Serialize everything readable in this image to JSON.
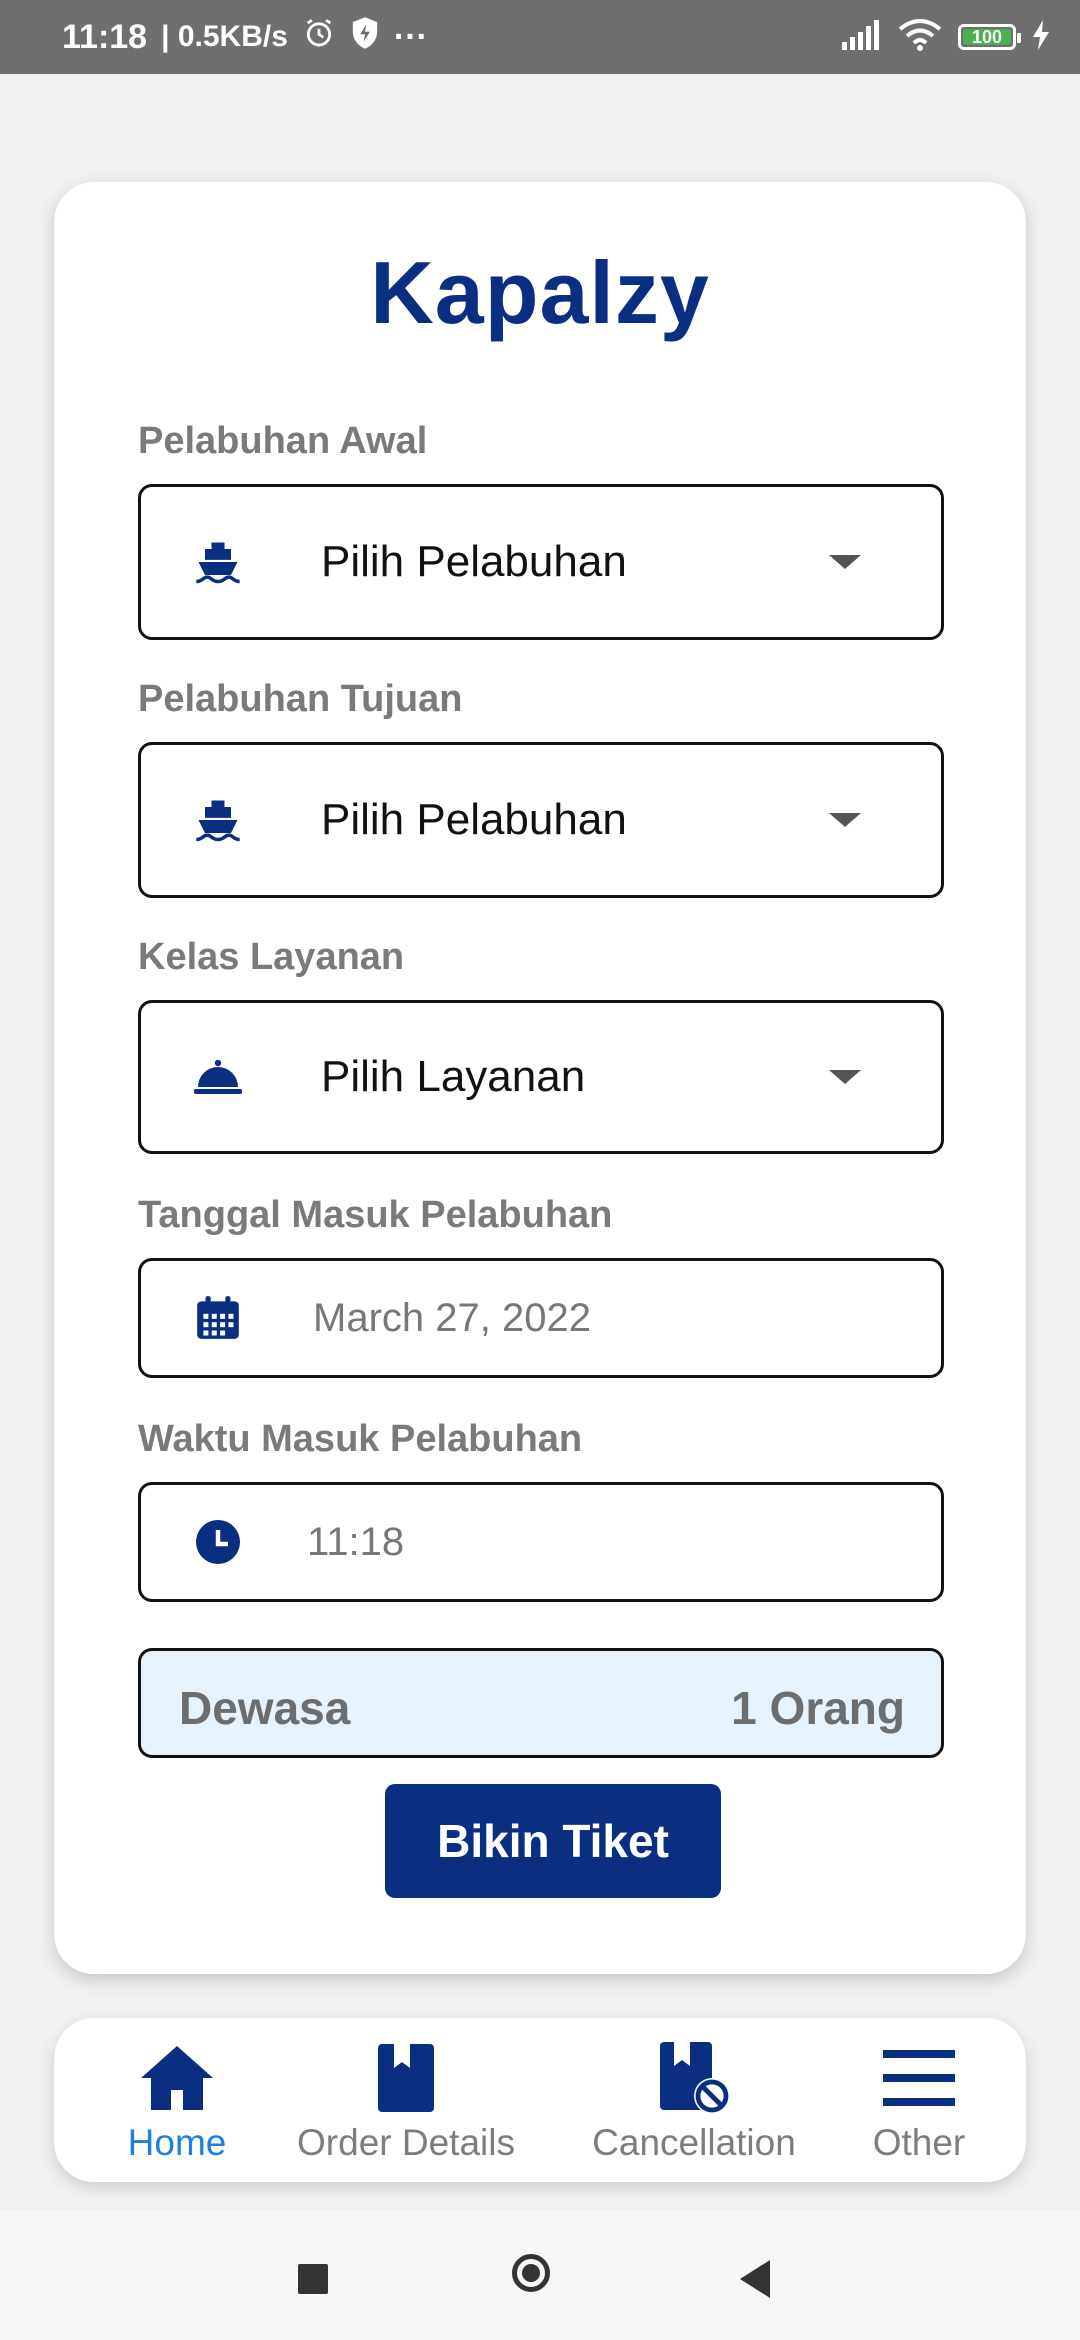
{
  "status_bar": {
    "time": "11:18",
    "speed": "| 0.5KB/s",
    "more": "···",
    "battery": "100"
  },
  "app": {
    "title": "Kapalzy"
  },
  "form": {
    "origin": {
      "label": "Pelabuhan Awal",
      "value": "Pilih Pelabuhan",
      "icon": "ship-icon"
    },
    "destination": {
      "label": "Pelabuhan Tujuan",
      "value": "Pilih Pelabuhan",
      "icon": "ship-icon"
    },
    "service_class": {
      "label": "Kelas Layanan",
      "value": "Pilih Layanan",
      "icon": "service-bell-icon"
    },
    "date": {
      "label": "Tanggal Masuk Pelabuhan",
      "value": "March 27, 2022",
      "icon": "calendar-icon"
    },
    "time": {
      "label": "Waktu Masuk Pelabuhan",
      "value": "11:18",
      "icon": "clock-icon"
    },
    "passengers": {
      "label": "Dewasa",
      "count": "1 Orang"
    },
    "submit_label": "Bikin Tiket"
  },
  "bottom_nav": {
    "items": [
      {
        "label": "Home",
        "icon": "home-icon",
        "active": true
      },
      {
        "label": "Order Details",
        "icon": "bookmark-icon",
        "active": false
      },
      {
        "label": "Cancellation",
        "icon": "bookmark-cancel-icon",
        "active": false
      },
      {
        "label": "Other",
        "icon": "menu-icon",
        "active": false
      }
    ]
  },
  "colors": {
    "primary": "#0b2f80",
    "active_nav": "#1e7fe0",
    "passenger_bg": "#e6f3fd",
    "status_bar": "#6f6f6f"
  }
}
